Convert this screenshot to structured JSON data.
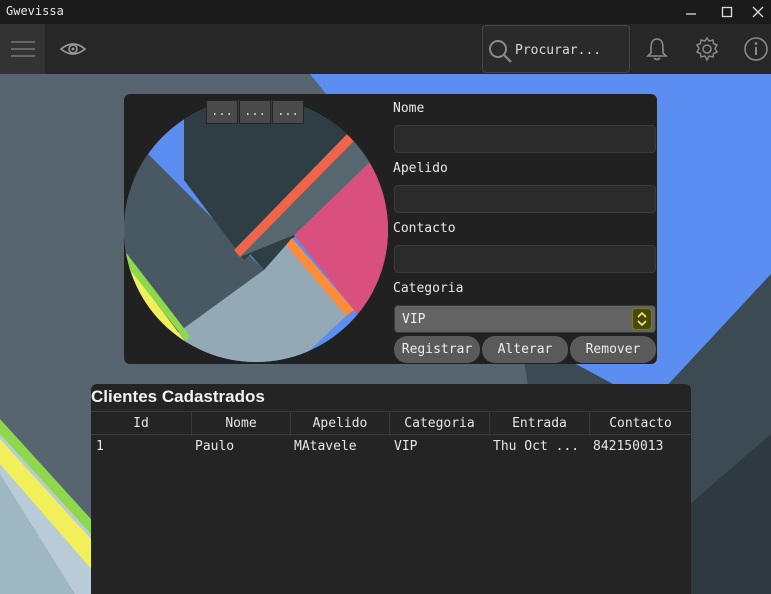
{
  "window": {
    "title": "Gwevissa"
  },
  "toolbar": {
    "search_placeholder": "Procurar...",
    "icons": [
      "menu-icon",
      "eye-icon",
      "search-icon",
      "bell-icon",
      "gear-icon",
      "info-icon"
    ]
  },
  "form": {
    "dots": [
      "...",
      "...",
      "..."
    ],
    "labels": {
      "nome": "Nome",
      "apelido": "Apelido",
      "contacto": "Contacto",
      "categoria": "Categoria"
    },
    "values": {
      "nome": "",
      "apelido": "",
      "contacto": ""
    },
    "categoria_selected": "VIP",
    "buttons": {
      "registrar": "Registrar",
      "alterar": "Alterar",
      "remover": "Remover"
    }
  },
  "table": {
    "title": "Clientes Cadastrados",
    "columns": [
      "Id",
      "Nome",
      "Apelido",
      "Categoria",
      "Entrada",
      "Contacto"
    ],
    "rows": [
      [
        "1",
        "Paulo",
        "MAtavele",
        "VIP",
        "Thu Oct ...",
        "842150013"
      ]
    ]
  },
  "colors": {
    "accent_blue": "#5b8ef0",
    "panel": "#212121",
    "select_spin": "#4a4a00"
  }
}
